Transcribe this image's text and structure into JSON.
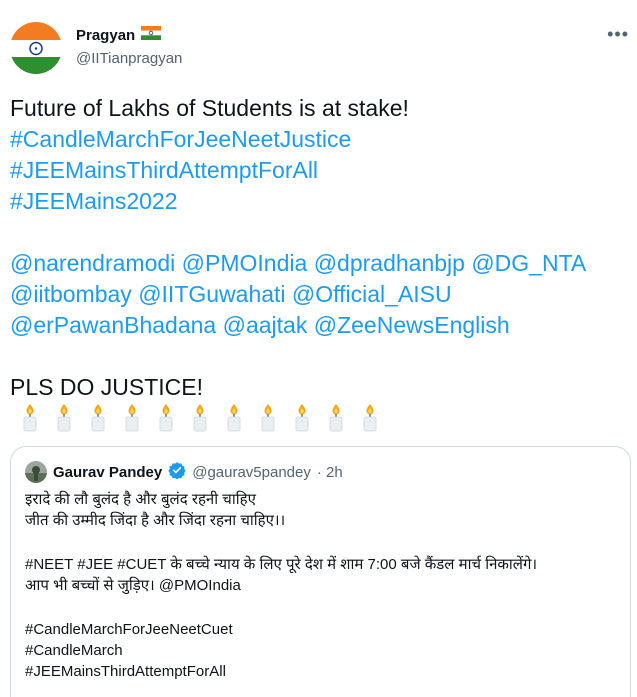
{
  "author": {
    "display_name": "Pragyan",
    "flag": "🇮🇳",
    "handle": "@IITianpragyan",
    "avatar_icon": "india-flag-avatar"
  },
  "tweet": {
    "lines": [
      {
        "text": "Future of Lakhs of Students is at stake!",
        "link": false
      },
      {
        "text": "#CandleMarchForJeeNeetJustice",
        "link": true
      },
      {
        "text": "#JEEMainsThirdAttemptForAll",
        "link": true
      },
      {
        "text": "#JEEMains2022",
        "link": true
      }
    ],
    "mentions": [
      [
        "@narendramodi",
        "@PMOIndia",
        "@dpradhanbjp",
        "@DG_NTA"
      ],
      [
        "@iitbombay",
        "@IITGuwahati",
        "@Official_AISU"
      ],
      [
        "@erPawanBhadana",
        "@aajtak",
        "@ZeeNewsEnglish"
      ]
    ],
    "closing": "PLS DO JUSTICE!",
    "candle_count": 11
  },
  "quote": {
    "display_name": "Gaurav Pandey",
    "handle": "@gaurav5pandey",
    "time": "· 2h",
    "line1": "इरादे की लौ बुलंद है और बुलंद रहनी चाहिए",
    "line2": "जीत की उम्मीद जिंदा है और जिंदा रहना चाहिए।।",
    "line3": "#NEET #JEE #CUET के बच्चे न्याय के लिए पूरे देश में शाम 7:00 बजे कैंडल मार्च निकालेंगे।",
    "line4": "आप भी बच्चों से जुड़िए। @PMOIndia",
    "tag1": "#CandleMarchForJeeNeetCuet",
    "tag2": "#CandleMarch",
    "tag3": "#JEEMainsThirdAttemptForAll"
  },
  "colors": {
    "link": "#1d9bf0",
    "text": "#0f1419",
    "secondary": "#536471",
    "border": "#cfd9de"
  }
}
